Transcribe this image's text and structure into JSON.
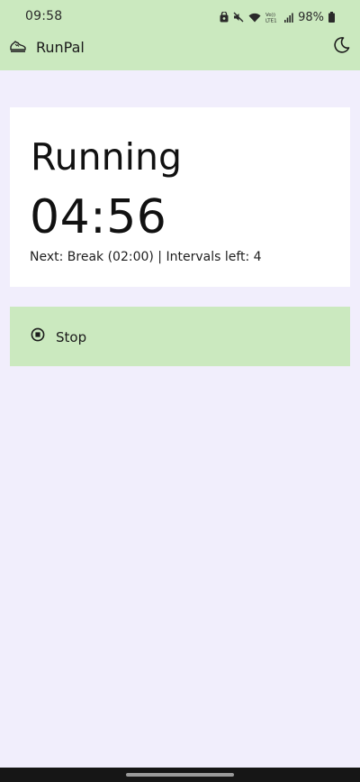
{
  "status_bar": {
    "time": "09:58",
    "battery": "98%",
    "icons": [
      "lock-badge-icon",
      "mute-icon",
      "wifi-icon",
      "volte-lte-icon",
      "signal-icon",
      "battery-icon"
    ]
  },
  "app_bar": {
    "title": "RunPal",
    "logo_icon": "running-shoe-icon",
    "theme_icon": "moon-icon"
  },
  "status_card": {
    "phase": "Running",
    "timer": "04:56",
    "next_info": "Next: Break (02:00) | Intervals left: 4"
  },
  "stop_button": {
    "label": "Stop",
    "icon": "stop-circle-icon"
  },
  "colors": {
    "accent": "#cbe9bf",
    "background": "#f1eefc",
    "card": "#ffffff"
  }
}
